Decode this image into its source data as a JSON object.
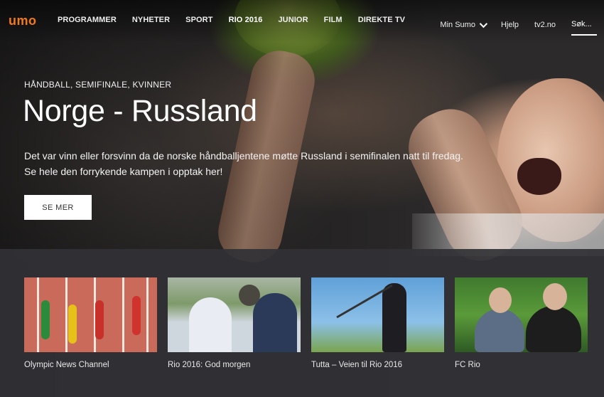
{
  "logo": "umo",
  "nav": {
    "links": [
      "PROGRAMMER",
      "NYHETER",
      "SPORT",
      "RIO 2016",
      "JUNIOR",
      "FILM",
      "DIREKTE TV"
    ],
    "active": "RIO 2016",
    "right": {
      "my_sumo": "Min Sumo",
      "help": "Hjelp",
      "external": "tv2.no",
      "search_placeholder": "Søk..."
    }
  },
  "hero": {
    "kicker": "HÅNDBALL, SEMIFINALE, KVINNER",
    "title": "Norge - Russland",
    "lead": "Det var vinn eller forsvinn da de norske håndballjentene møtte Russland i semifinalen natt til fredag. Se hele den forrykende kampen i opptak her!",
    "cta": "SE MER"
  },
  "cards": [
    {
      "title": "Olympic News Channel",
      "image": "sprinters-track"
    },
    {
      "title": "Rio 2016: God morgen",
      "image": "golf-players"
    },
    {
      "title": "Tutta – Veien til Rio 2016",
      "image": "golfer-swing"
    },
    {
      "title": "FC Rio",
      "image": "studio-hosts"
    }
  ],
  "colors": {
    "brand": "#f27a1a",
    "cta_bg": "#ffffff",
    "panel_bg": "#323236"
  }
}
